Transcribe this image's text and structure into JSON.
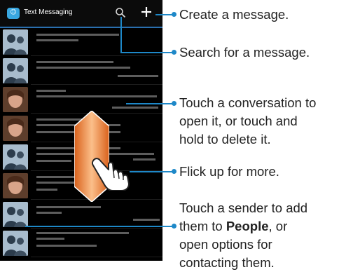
{
  "app": {
    "title": "Text Messaging"
  },
  "icons": {
    "app": "messaging-app-icon",
    "search": "search-icon",
    "add": "plus-icon"
  },
  "callouts": {
    "create": "Create a message.",
    "search": "Search for a message.",
    "conversation_l1": "Touch a conversation to",
    "conversation_l2": "open it, or touch and",
    "conversation_l3": "hold to delete it.",
    "flick": "Flick up for more.",
    "sender_l1": "Touch a sender to add",
    "sender_l2_pre": "them to ",
    "sender_l2_bold": "People",
    "sender_l2_post": ", or",
    "sender_l3": "open options for",
    "sender_l4": "contacting them."
  },
  "colors": {
    "accent": "#1e88c8",
    "header_line": "#2a6fae",
    "flick_arrow": "#f07c2a",
    "phone_bg": "#000000"
  },
  "conversations": [
    {
      "avatar": "generic"
    },
    {
      "avatar": "generic"
    },
    {
      "avatar": "photo"
    },
    {
      "avatar": "photo"
    },
    {
      "avatar": "generic"
    },
    {
      "avatar": "photo"
    },
    {
      "avatar": "generic"
    },
    {
      "avatar": "generic"
    }
  ]
}
